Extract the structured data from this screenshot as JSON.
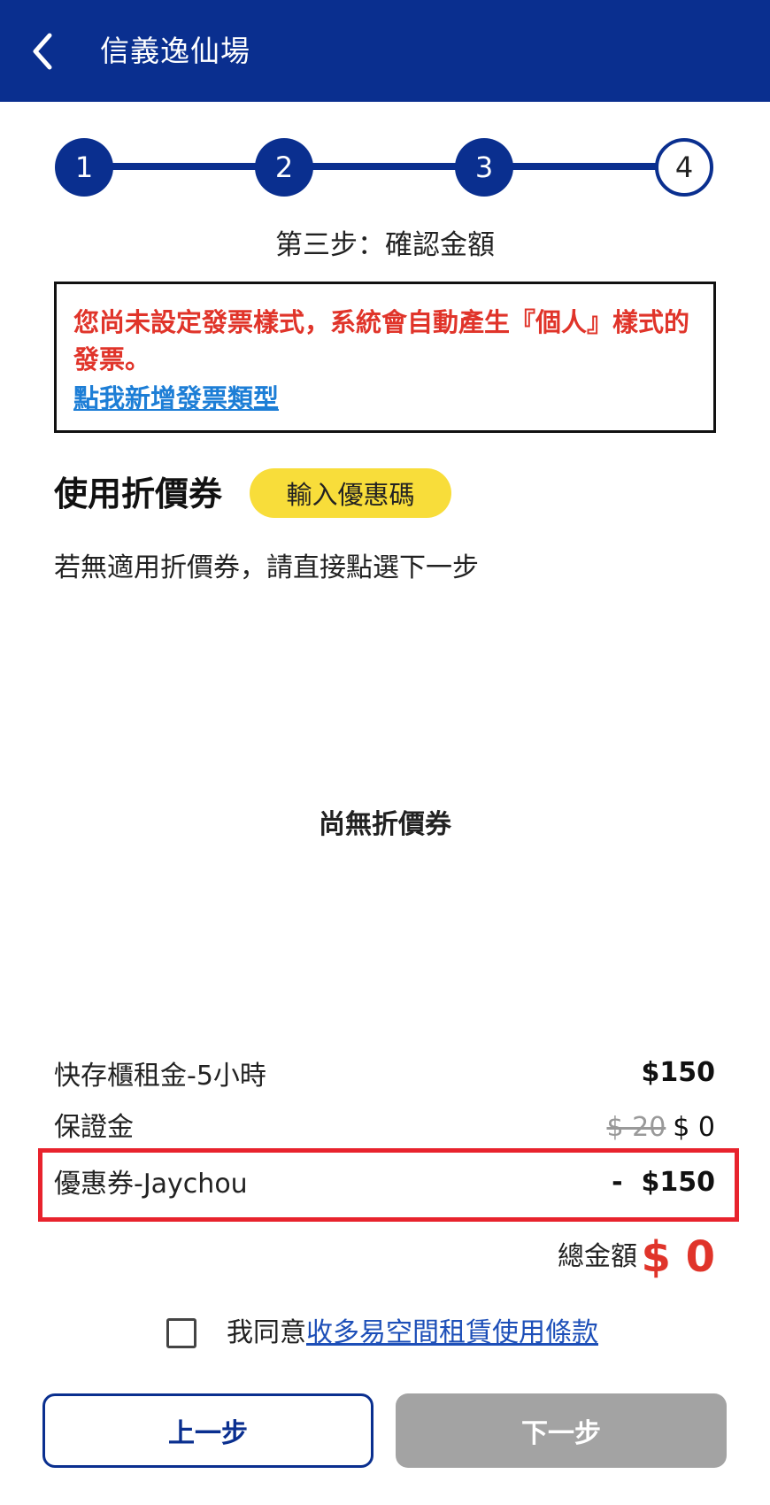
{
  "header": {
    "title": "信義逸仙場",
    "back_icon": "chevron-left-icon"
  },
  "stepper": {
    "steps": [
      "1",
      "2",
      "3",
      "4"
    ],
    "current_step": 4,
    "caption": "第三步：確認金額"
  },
  "invoice_notice": {
    "message": "您尚未設定發票樣式，系統會自動產生『個人』樣式的發票。",
    "link_text": "點我新增發票類型"
  },
  "coupon": {
    "title": "使用折價券",
    "promo_button": "輸入優惠碼",
    "hint": "若無適用折價券，請直接點選下一步",
    "empty_text": "尚無折價券"
  },
  "summary": {
    "rows": [
      {
        "label": "快存櫃租金-5小時",
        "value": "$150"
      },
      {
        "label": "保證金",
        "original_value": "$ 20",
        "value": "$ 0"
      },
      {
        "label": "優惠券-Jaychou",
        "value": "-  $150"
      }
    ],
    "total_label": "總金額",
    "total_value": "$ 0"
  },
  "agreement": {
    "prefix": "我同意",
    "link_text": "收多易空間租賃使用條款",
    "checked": false
  },
  "buttons": {
    "prev": "上一步",
    "next": "下一步"
  },
  "colors": {
    "brand_blue": "#0a2f8f",
    "alert_red": "#e0342a",
    "highlight_red": "#e8232d",
    "promo_yellow": "#f8dd3a",
    "disabled_gray": "#a3a3a3",
    "link_blue": "#1d7ed6"
  }
}
